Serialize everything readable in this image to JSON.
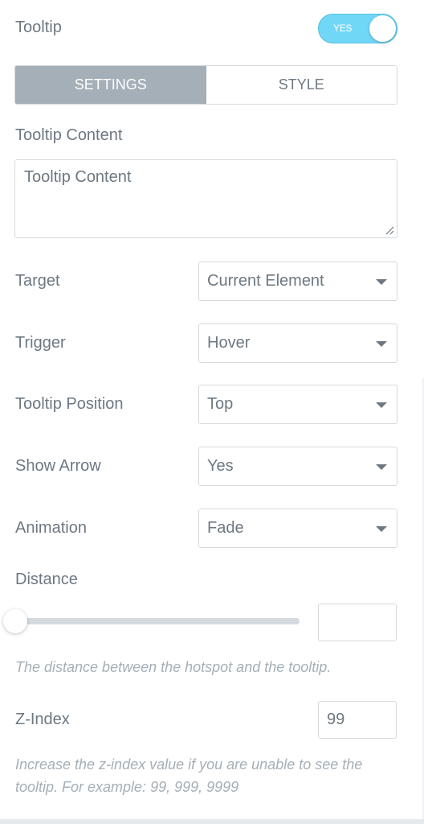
{
  "tooltip_toggle": {
    "label": "Tooltip",
    "state_label": "YES",
    "enabled": true,
    "accent_color": "#71d7f7"
  },
  "tabs": [
    {
      "label": "SETTINGS",
      "active": true
    },
    {
      "label": "STYLE",
      "active": false
    }
  ],
  "tooltip_content": {
    "label": "Tooltip Content",
    "value": "Tooltip Content"
  },
  "fields": {
    "target": {
      "label": "Target",
      "value": "Current Element"
    },
    "trigger": {
      "label": "Trigger",
      "value": "Hover"
    },
    "position": {
      "label": "Tooltip Position",
      "value": "Top"
    },
    "show_arrow": {
      "label": "Show Arrow",
      "value": "Yes"
    },
    "animation": {
      "label": "Animation",
      "value": "Fade"
    }
  },
  "distance": {
    "label": "Distance",
    "value": "",
    "slider_fraction": 0,
    "description": "The distance between the hotspot and the tooltip."
  },
  "z_index": {
    "label": "Z-Index",
    "value": "99",
    "description_line1": "Increase the z-index value if you are unable to see the",
    "description_line2": "tooltip. For example: 99, 999, 9999"
  },
  "icons": {
    "dropdown": "caret-down-icon",
    "resize": "resize-handle-icon"
  }
}
